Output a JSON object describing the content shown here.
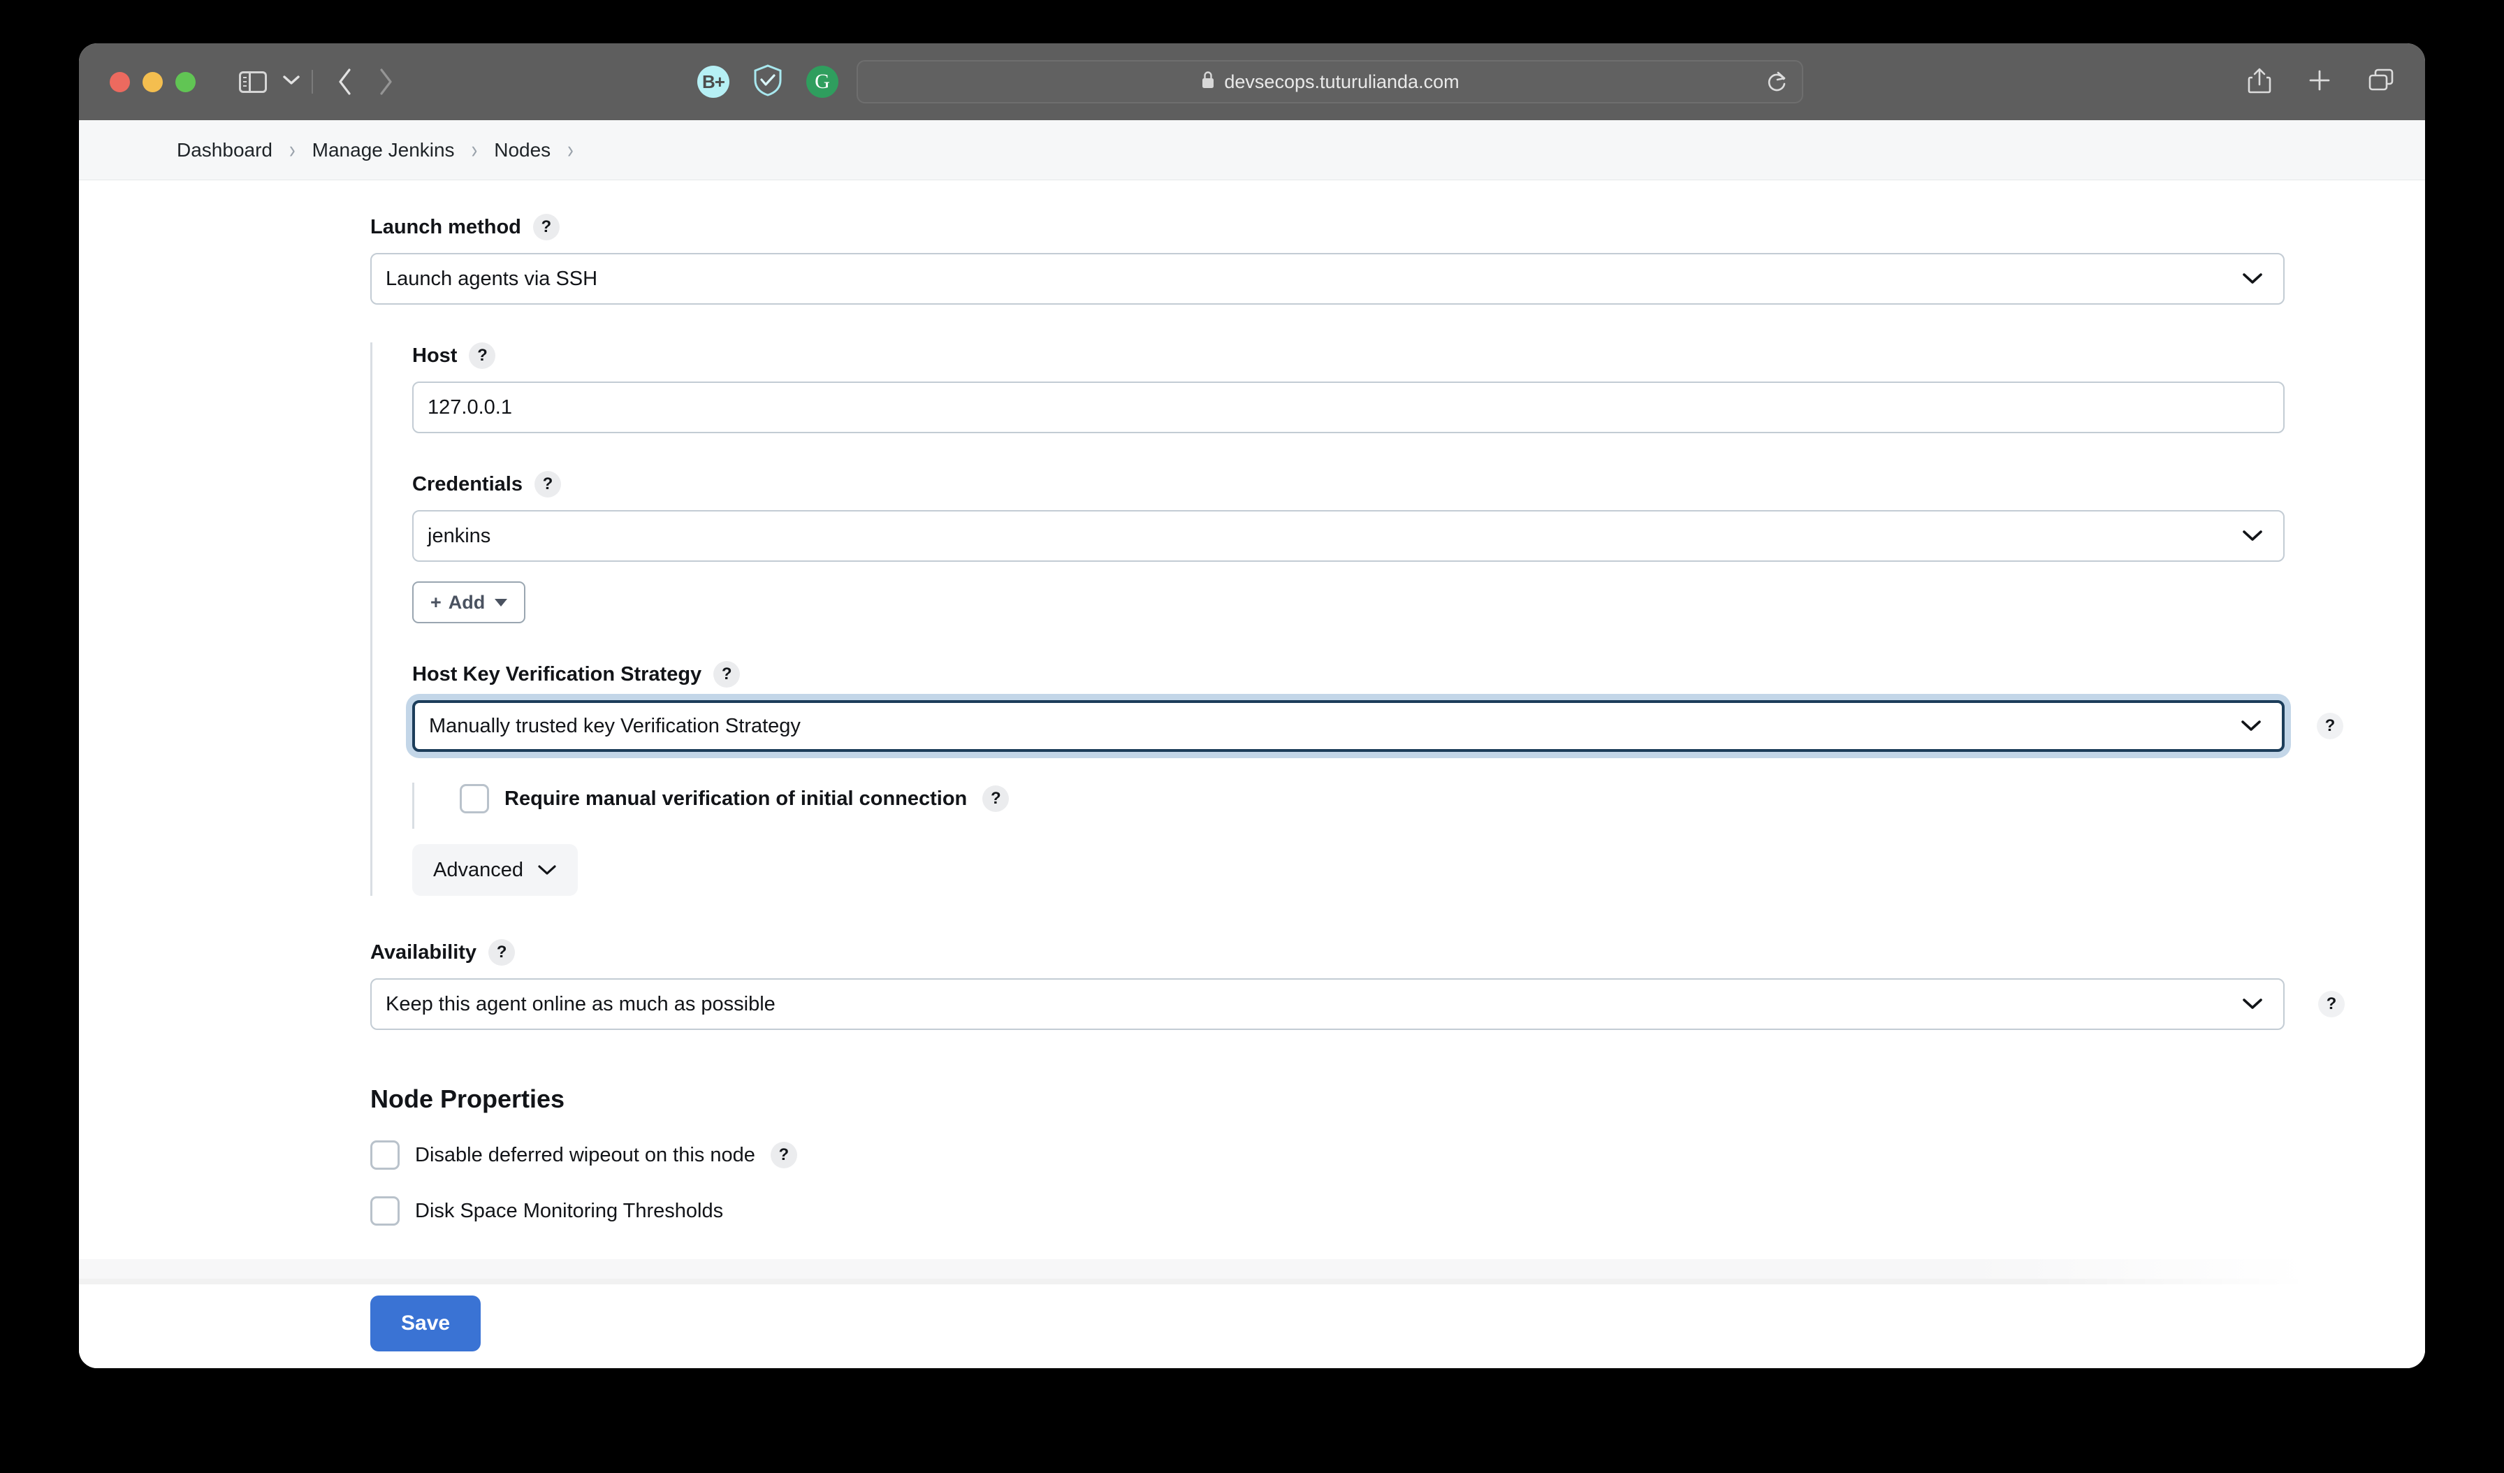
{
  "browser": {
    "url": "devsecops.tuturulianda.com",
    "lock_icon": "lock-icon",
    "reload_icon": "reload-icon",
    "back_icon": "back-chevron-icon",
    "forward_icon": "forward-chevron-icon",
    "sidebar_icon": "sidebar-toggle-icon",
    "tab_menu_icon": "chevron-down-icon",
    "share_icon": "share-icon",
    "new_tab_icon": "plus-icon",
    "tab_overview_icon": "tab-overview-icon",
    "extensions": [
      {
        "name": "bitwarden-extension-icon",
        "label": "B+"
      },
      {
        "name": "shield-check-extension-icon",
        "label": ""
      },
      {
        "name": "grammarly-extension-icon",
        "label": "G"
      }
    ]
  },
  "breadcrumb": {
    "items": [
      "Dashboard",
      "Manage Jenkins",
      "Nodes"
    ],
    "separator": "›"
  },
  "form": {
    "launch_method": {
      "label": "Launch method",
      "help": "?",
      "value": "Launch agents via SSH"
    },
    "host": {
      "label": "Host",
      "help": "?",
      "value": "127.0.0.1"
    },
    "credentials": {
      "label": "Credentials",
      "help": "?",
      "value": "jenkins",
      "add_button": "Add",
      "add_plus": "+"
    },
    "host_key_strategy": {
      "label": "Host Key Verification Strategy",
      "help": "?",
      "value": "Manually trusted key Verification Strategy",
      "side_help": "?"
    },
    "require_manual_verification": {
      "label": "Require manual verification of initial connection",
      "help": "?",
      "checked": false
    },
    "advanced_button": {
      "label": "Advanced",
      "icon": "chevron-down-icon"
    },
    "availability": {
      "label": "Availability",
      "help": "?",
      "value": "Keep this agent online as much as possible",
      "side_help": "?"
    }
  },
  "node_properties": {
    "title": "Node Properties",
    "items": [
      {
        "label": "Disable deferred wipeout on this node",
        "help": "?",
        "checked": false
      },
      {
        "label": "Disk Space Monitoring Thresholds",
        "help": "",
        "checked": false
      }
    ]
  },
  "footer": {
    "save_label": "Save"
  },
  "colors": {
    "accent": "#3a73d4",
    "focus_border": "#1c3d5a",
    "focus_ring": "#c3d6e8",
    "toolbar_bg": "#5e5e5e",
    "breadcrumb_bg": "#f6f7f8"
  }
}
